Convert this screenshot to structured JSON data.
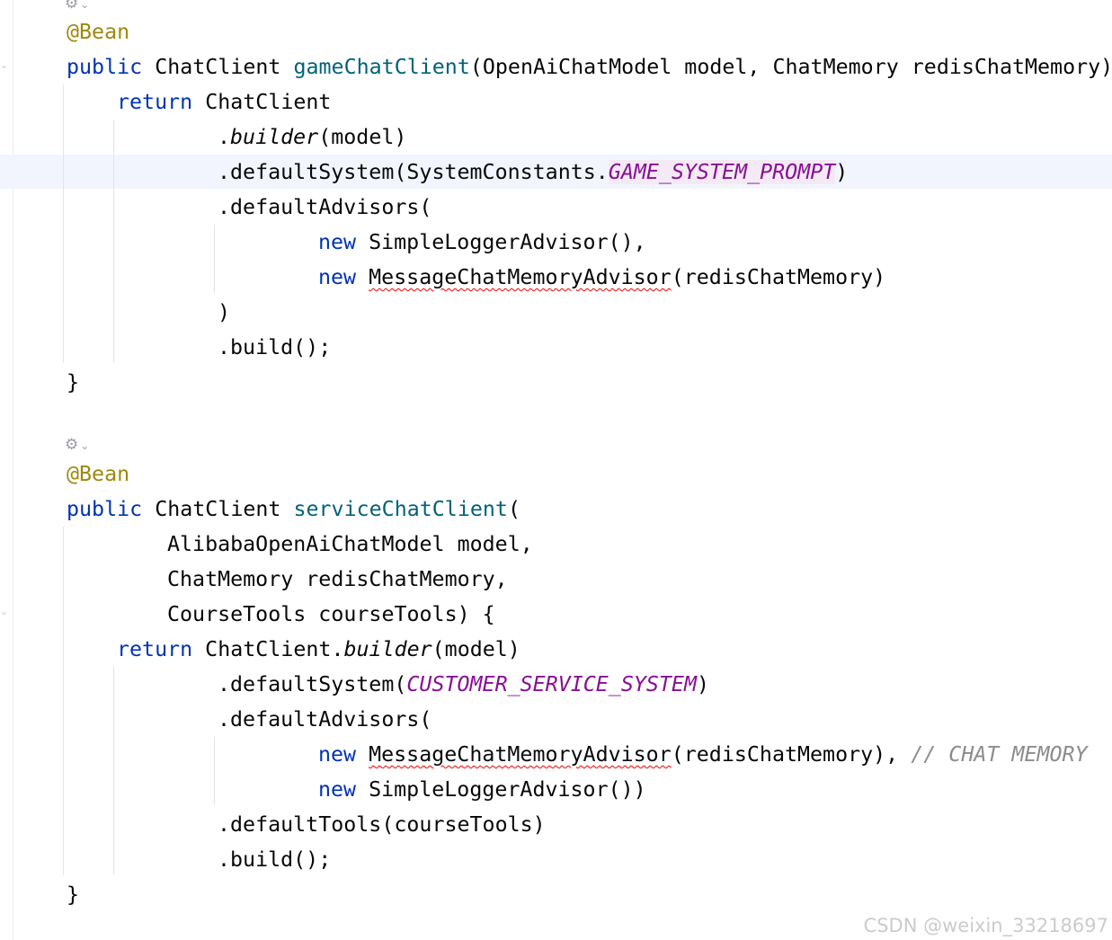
{
  "editor": {
    "annotation": "@Bean",
    "kw_public": "public",
    "kw_return": "return",
    "kw_new": "new",
    "type_chat_client": "ChatClient",
    "close_brace": "}",
    "icon_name": "spring-bean-gutter-icon"
  },
  "method1": {
    "name": "gameChatClient",
    "params": "(OpenAiChatModel model, ChatMemory redisChatMemory)",
    "return_target": "ChatClient",
    "builder_dot": ".",
    "builder_call": "builder",
    "builder_args": "(model)",
    "default_system_prefix": ".defaultSystem(SystemConstants.",
    "default_system_const": "GAME_SYSTEM_PROMPT",
    "default_system_suffix": ")",
    "default_advisors_open": ".defaultAdvisors(",
    "advisor1_type": "SimpleLoggerAdvisor",
    "advisor1_args": "(),",
    "advisor2_type": "MessageChatMemoryAdvisor",
    "advisor2_args": "(redisChatMemory)",
    "advisors_close": ")",
    "build_call": ".build();"
  },
  "method2": {
    "name": "serviceChatClient",
    "params_open": "(",
    "param1": "AlibabaOpenAiChatModel model,",
    "param2": "ChatMemory redisChatMemory,",
    "param3": "CourseTools courseTools) {",
    "return_rest": " ChatClient.",
    "builder_call": "builder",
    "builder_args": "(model)",
    "default_system_prefix": ".defaultSystem(",
    "default_system_const": "CUSTOMER_SERVICE_SYSTEM",
    "default_system_suffix": ")",
    "default_advisors_open": ".defaultAdvisors(",
    "advisor1_type": "MessageChatMemoryAdvisor",
    "advisor1_args": "(redisChatMemory), ",
    "advisor1_comment": "// CHAT MEMORY",
    "advisor2_type": "SimpleLoggerAdvisor",
    "advisor2_args": "())",
    "default_tools": ".defaultTools(courseTools)",
    "build_call": ".build();"
  },
  "watermark": "CSDN @weixin_33218697"
}
